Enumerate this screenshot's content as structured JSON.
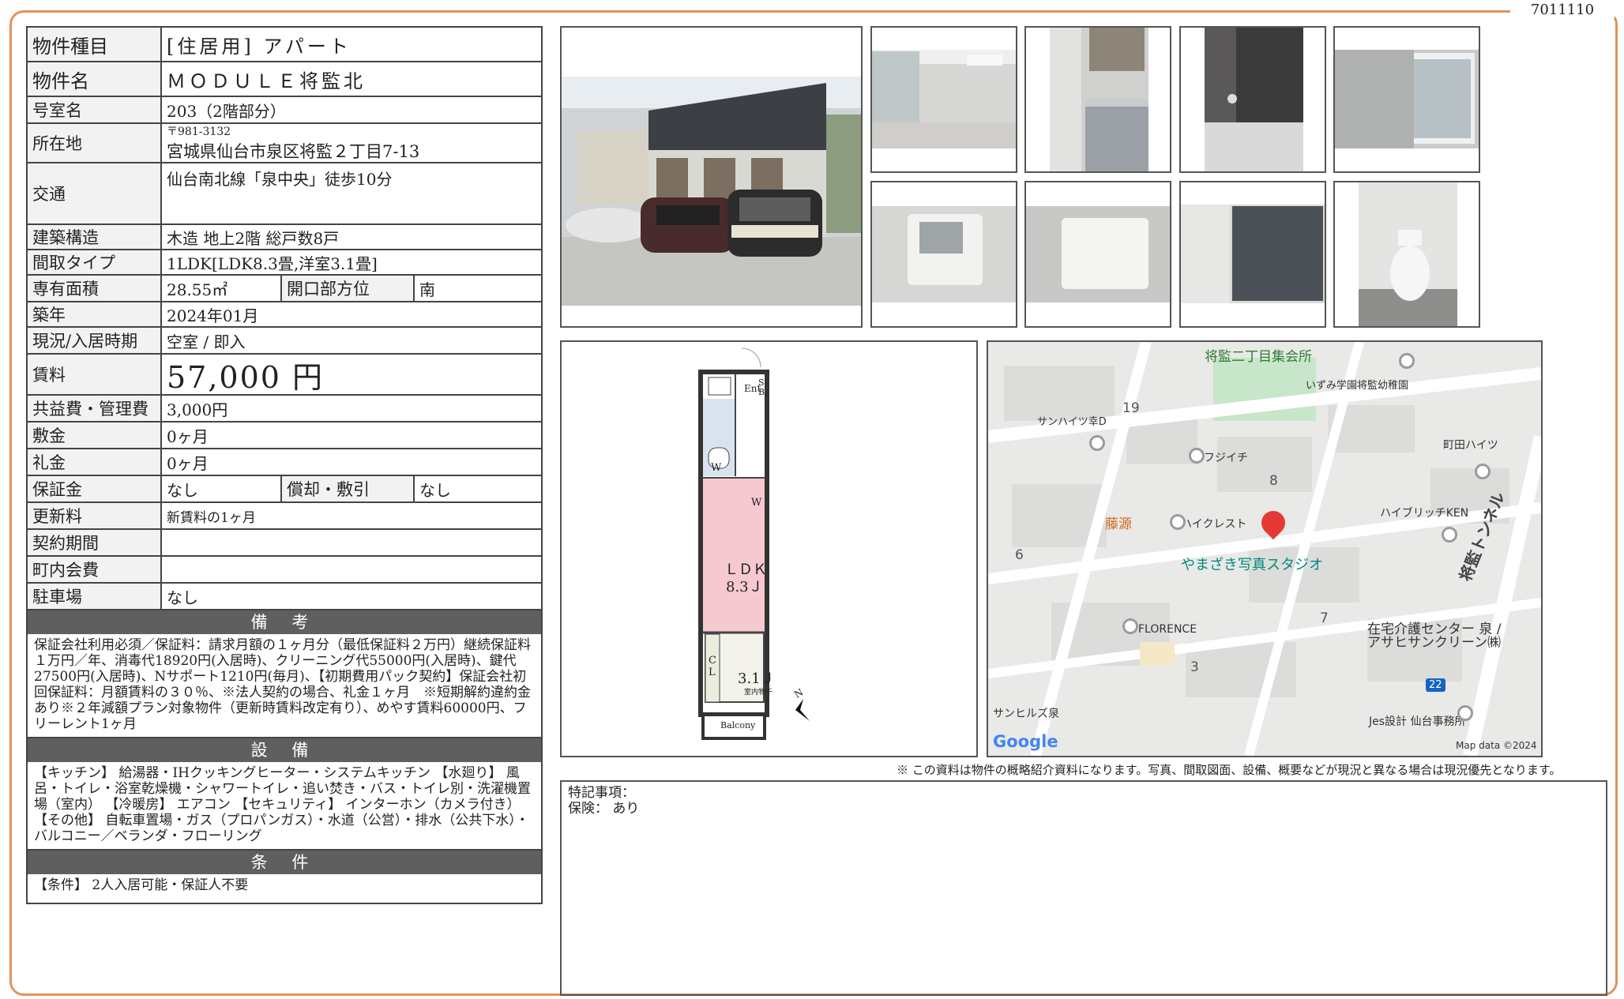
{
  "doc_id": "7011110",
  "info": {
    "type_label": "物件種目",
    "type_value": "[住居用]  アパート",
    "name_label": "物件名",
    "name_value": "ＭＯＤＵＬＥ将監北",
    "room_label": "号室名",
    "room_value": "203（2階部分）",
    "address_label": "所在地",
    "zip": "〒981-3132",
    "address_value": "宮城県仙台市泉区将監２丁目7-13",
    "access_label": "交通",
    "access_value": "仙台南北線「泉中央」徒歩10分",
    "structure_label": "建築構造",
    "structure_value": "木造  地上2階  総戸数8戸",
    "layout_label": "間取タイプ",
    "layout_value": "1LDK[LDK8.3畳,洋室3.1畳]",
    "area_label": "専有面積",
    "area_value": "28.55㎡",
    "direction_label": "開口部方位",
    "direction_value": "南",
    "built_label": "築年",
    "built_value": "2024年01月",
    "status_label": "現況/入居時期",
    "status_value": "空室 / 即入",
    "rent_label": "賃料",
    "rent_value": "57,000 円",
    "fee_label": "共益費・管理費",
    "fee_value": "3,000円",
    "deposit_label": "敷金",
    "deposit_value": "0ヶ月",
    "keymoney_label": "礼金",
    "keymoney_value": "0ヶ月",
    "guarantee_label": "保証金",
    "guarantee_value": "なし",
    "amort_label": "償却・敷引",
    "amort_value": "なし",
    "renewal_label": "更新料",
    "renewal_value": "新賃料の1ヶ月",
    "contract_label": "契約期間",
    "contract_value": "",
    "community_label": "町内会費",
    "community_value": "",
    "parking_label": "駐車場",
    "parking_value": "なし",
    "remarks_header": "備 考",
    "remarks_text": "保証会社利用必須／保証料：請求月額の１ヶ月分（最低保証料２万円）継続保証料１万円／年、消毒代18920円(入居時)、クリーニング代55000円(入居時)、鍵代27500円(入居時)、Nサポート1210円(毎月)、【初期費用パック契約】保証会社初回保証料：月額賃料の３０％、※法人契約の場合、礼金１ヶ月　※短期解約違約金あり※２年減額プラン対象物件（更新時賃料改定有り）、めやす賃料60000円、フリーレント1ヶ月",
    "equipment_header": "設 備",
    "equipment_text": "【キッチン】 給湯器・IHクッキングヒーター・システムキッチン 【水廻り】 風呂・トイレ・浴室乾燥機・シャワートイレ・追い焚き・バス・トイレ別・洗濯機置場（室内） 【冷暖房】 エアコン 【セキュリティ】 インターホン（カメラ付き） 【その他】 自転車置場・ガス（プロパンガス）・水道（公営）・排水（公共下水）・バルコニー／ベランダ・フローリング",
    "conditions_header": "条 件",
    "conditions_text": "【条件】 2人入居可能・保証人不要"
  },
  "floorplan": {
    "ent": "Ent",
    "sb": "S B",
    "w1": "W",
    "w2": "W",
    "ldk": "ＬＤＫ",
    "ldk_size": "8.3Ｊ",
    "cl": "C L",
    "room_size": "3.1Ｊ",
    "indoor_dry": "室内物干",
    "balcony": "Balcony",
    "north": "N"
  },
  "map": {
    "labels": {
      "community_hall": "将監二丁目集会所",
      "kindergarten": "いずみ学園将監幼稚園",
      "sunheights": "サンハイツ幸D",
      "fujiichi": "フジイチ",
      "machida": "町田ハイツ",
      "fujigen": "藤源",
      "haicrest": "ハイクレスト",
      "hyblitch": "ハイブリッチKEN",
      "studio": "やまざき写真スタジオ",
      "tunnel": "将監トンネル",
      "florence": "FLORENCE",
      "care_center": "在宅介護センター 泉 /\nアサヒサンクリーン㈱",
      "sunhills": "サンヒルズ泉",
      "jes": "Jes設計 仙台事務所",
      "google": "Google",
      "mapdata": "Map data ©2024"
    },
    "numbers": {
      "n19": "19",
      "n8": "8",
      "n6": "6",
      "n7": "7",
      "n3": "3",
      "route": "22"
    }
  },
  "note": "※ この資料は物件の概略紹介資料になります。写真、間取図面、設備、概要などが現況と異なる場合は現況優先となります。",
  "remark_box": {
    "title": "特記事項：",
    "insurance": "保険： あり"
  }
}
